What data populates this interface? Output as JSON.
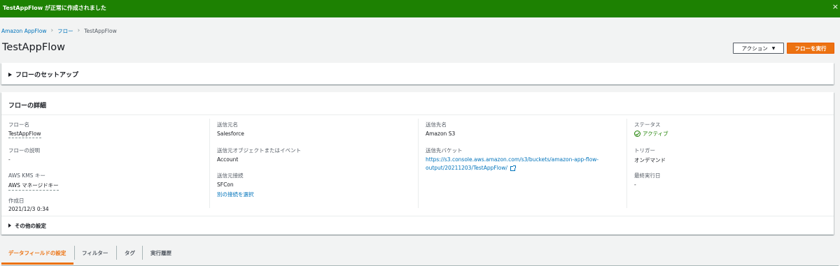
{
  "banner": {
    "message": "TestAppFlow が正常に作成されました",
    "close_label": "×"
  },
  "breadcrumb": {
    "items": [
      "Amazon AppFlow",
      "フロー",
      "TestAppFlow"
    ],
    "separator": ">"
  },
  "page": {
    "title": "TestAppFlow"
  },
  "actions": {
    "action_label": "アクション",
    "run_label": "フローを実行"
  },
  "setup_section": {
    "title": "フローのセットアップ"
  },
  "details": {
    "title": "フローの詳細",
    "flow_name_label": "フロー名",
    "flow_name_value": "TestAppFlow",
    "flow_desc_label": "フローの説明",
    "flow_desc_value": "-",
    "kms_label": "AWS KMS キー",
    "kms_value": "AWS マネージドキー",
    "created_label": "作成日",
    "created_value": "2021/12/3 0:34",
    "source_name_label": "送信元名",
    "source_name_value": "Salesforce",
    "source_object_label": "送信元オブジェクトまたはイベント",
    "source_object_value": "Account",
    "source_conn_label": "送信元接続",
    "source_conn_value": "SFCon",
    "select_other_conn": "別の接続を選択",
    "dest_name_label": "送信先名",
    "dest_name_value": "Amazon S3",
    "dest_bucket_label": "送信先バケット",
    "dest_bucket_line1": "https://s3.console.aws.amazon.com/s3/buckets/amazon-app-flow-",
    "dest_bucket_line2": "output/20211203/TestAppFlow/",
    "status_label": "ステータス",
    "status_value": "アクティブ",
    "trigger_label": "トリガー",
    "trigger_value": "オンデマンド",
    "last_run_label": "最終実行日",
    "last_run_value": "-",
    "other_settings": "その他の設定"
  },
  "tabs": [
    {
      "label": "データフィールドの設定",
      "active": true
    },
    {
      "label": "フィルター",
      "active": false
    },
    {
      "label": "タグ",
      "active": false
    },
    {
      "label": "実行履歴",
      "active": false
    }
  ],
  "colors": {
    "success": "#1d8102",
    "accent": "#ec7211",
    "link": "#0073bb"
  }
}
